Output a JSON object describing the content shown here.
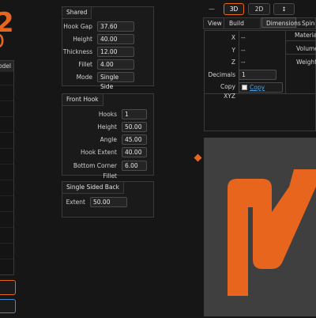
{
  "left": {
    "logo_char": "2",
    "logo_sub_char": "D",
    "list_header": "Model"
  },
  "shared": {
    "title": "Shared",
    "fields": [
      {
        "label": "Hook Gap",
        "value": "37.60"
      },
      {
        "label": "Height",
        "value": "40.00"
      },
      {
        "label": "Thickness",
        "value": "12.00"
      },
      {
        "label": "Fillet",
        "value": "4.00"
      },
      {
        "label": "Mode",
        "value": "Single Side"
      }
    ]
  },
  "front_hook": {
    "title": "Front Hook",
    "fields": [
      {
        "label": "Hooks",
        "value": "1"
      },
      {
        "label": "Height",
        "value": "50.00"
      },
      {
        "label": "Angle",
        "value": "45.00"
      },
      {
        "label": "Hook Extent",
        "value": "40.00"
      },
      {
        "label": "Bottom Corner Fillet",
        "value": "6.00"
      }
    ]
  },
  "single_sided_back": {
    "title": "Single Sided Back",
    "fields": [
      {
        "label": "Extent",
        "value": "50.00"
      }
    ]
  },
  "toolbar": {
    "minus_label": "−",
    "btn_3d": "3D",
    "btn_2d": "2D",
    "btn_updown": "↕"
  },
  "tabs": [
    "View",
    "Build Area",
    "Dimensions",
    "Spin"
  ],
  "active_tab": "Dimensions",
  "dimensions": {
    "x_label": "X",
    "x_value": "--",
    "y_label": "Y",
    "y_value": "--",
    "z_label": "Z",
    "z_value": "--",
    "decimals_label": "Decimals",
    "decimals_value": "1",
    "copy_label": "Copy XYZ",
    "copy_link": "Copy"
  },
  "material": {
    "items": [
      "Material",
      "Volume",
      "Weight"
    ]
  },
  "colors": {
    "accent": "#e8651e",
    "link": "#4aa3e8",
    "viewport_bg": "#3f3f3f"
  }
}
